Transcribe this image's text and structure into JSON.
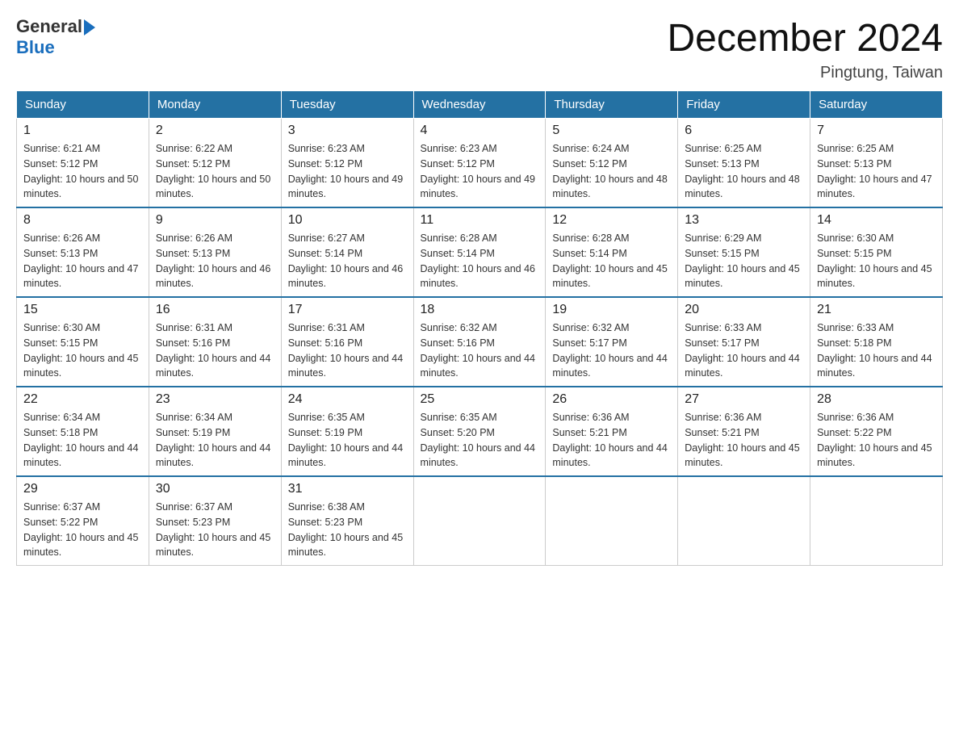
{
  "logo": {
    "general": "General",
    "blue": "Blue"
  },
  "title": "December 2024",
  "subtitle": "Pingtung, Taiwan",
  "days_header": [
    "Sunday",
    "Monday",
    "Tuesday",
    "Wednesday",
    "Thursday",
    "Friday",
    "Saturday"
  ],
  "weeks": [
    [
      {
        "day": "1",
        "sunrise": "6:21 AM",
        "sunset": "5:12 PM",
        "daylight": "10 hours and 50 minutes."
      },
      {
        "day": "2",
        "sunrise": "6:22 AM",
        "sunset": "5:12 PM",
        "daylight": "10 hours and 50 minutes."
      },
      {
        "day": "3",
        "sunrise": "6:23 AM",
        "sunset": "5:12 PM",
        "daylight": "10 hours and 49 minutes."
      },
      {
        "day": "4",
        "sunrise": "6:23 AM",
        "sunset": "5:12 PM",
        "daylight": "10 hours and 49 minutes."
      },
      {
        "day": "5",
        "sunrise": "6:24 AM",
        "sunset": "5:12 PM",
        "daylight": "10 hours and 48 minutes."
      },
      {
        "day": "6",
        "sunrise": "6:25 AM",
        "sunset": "5:13 PM",
        "daylight": "10 hours and 48 minutes."
      },
      {
        "day": "7",
        "sunrise": "6:25 AM",
        "sunset": "5:13 PM",
        "daylight": "10 hours and 47 minutes."
      }
    ],
    [
      {
        "day": "8",
        "sunrise": "6:26 AM",
        "sunset": "5:13 PM",
        "daylight": "10 hours and 47 minutes."
      },
      {
        "day": "9",
        "sunrise": "6:26 AM",
        "sunset": "5:13 PM",
        "daylight": "10 hours and 46 minutes."
      },
      {
        "day": "10",
        "sunrise": "6:27 AM",
        "sunset": "5:14 PM",
        "daylight": "10 hours and 46 minutes."
      },
      {
        "day": "11",
        "sunrise": "6:28 AM",
        "sunset": "5:14 PM",
        "daylight": "10 hours and 46 minutes."
      },
      {
        "day": "12",
        "sunrise": "6:28 AM",
        "sunset": "5:14 PM",
        "daylight": "10 hours and 45 minutes."
      },
      {
        "day": "13",
        "sunrise": "6:29 AM",
        "sunset": "5:15 PM",
        "daylight": "10 hours and 45 minutes."
      },
      {
        "day": "14",
        "sunrise": "6:30 AM",
        "sunset": "5:15 PM",
        "daylight": "10 hours and 45 minutes."
      }
    ],
    [
      {
        "day": "15",
        "sunrise": "6:30 AM",
        "sunset": "5:15 PM",
        "daylight": "10 hours and 45 minutes."
      },
      {
        "day": "16",
        "sunrise": "6:31 AM",
        "sunset": "5:16 PM",
        "daylight": "10 hours and 44 minutes."
      },
      {
        "day": "17",
        "sunrise": "6:31 AM",
        "sunset": "5:16 PM",
        "daylight": "10 hours and 44 minutes."
      },
      {
        "day": "18",
        "sunrise": "6:32 AM",
        "sunset": "5:16 PM",
        "daylight": "10 hours and 44 minutes."
      },
      {
        "day": "19",
        "sunrise": "6:32 AM",
        "sunset": "5:17 PM",
        "daylight": "10 hours and 44 minutes."
      },
      {
        "day": "20",
        "sunrise": "6:33 AM",
        "sunset": "5:17 PM",
        "daylight": "10 hours and 44 minutes."
      },
      {
        "day": "21",
        "sunrise": "6:33 AM",
        "sunset": "5:18 PM",
        "daylight": "10 hours and 44 minutes."
      }
    ],
    [
      {
        "day": "22",
        "sunrise": "6:34 AM",
        "sunset": "5:18 PM",
        "daylight": "10 hours and 44 minutes."
      },
      {
        "day": "23",
        "sunrise": "6:34 AM",
        "sunset": "5:19 PM",
        "daylight": "10 hours and 44 minutes."
      },
      {
        "day": "24",
        "sunrise": "6:35 AM",
        "sunset": "5:19 PM",
        "daylight": "10 hours and 44 minutes."
      },
      {
        "day": "25",
        "sunrise": "6:35 AM",
        "sunset": "5:20 PM",
        "daylight": "10 hours and 44 minutes."
      },
      {
        "day": "26",
        "sunrise": "6:36 AM",
        "sunset": "5:21 PM",
        "daylight": "10 hours and 44 minutes."
      },
      {
        "day": "27",
        "sunrise": "6:36 AM",
        "sunset": "5:21 PM",
        "daylight": "10 hours and 45 minutes."
      },
      {
        "day": "28",
        "sunrise": "6:36 AM",
        "sunset": "5:22 PM",
        "daylight": "10 hours and 45 minutes."
      }
    ],
    [
      {
        "day": "29",
        "sunrise": "6:37 AM",
        "sunset": "5:22 PM",
        "daylight": "10 hours and 45 minutes."
      },
      {
        "day": "30",
        "sunrise": "6:37 AM",
        "sunset": "5:23 PM",
        "daylight": "10 hours and 45 minutes."
      },
      {
        "day": "31",
        "sunrise": "6:38 AM",
        "sunset": "5:23 PM",
        "daylight": "10 hours and 45 minutes."
      },
      null,
      null,
      null,
      null
    ]
  ]
}
